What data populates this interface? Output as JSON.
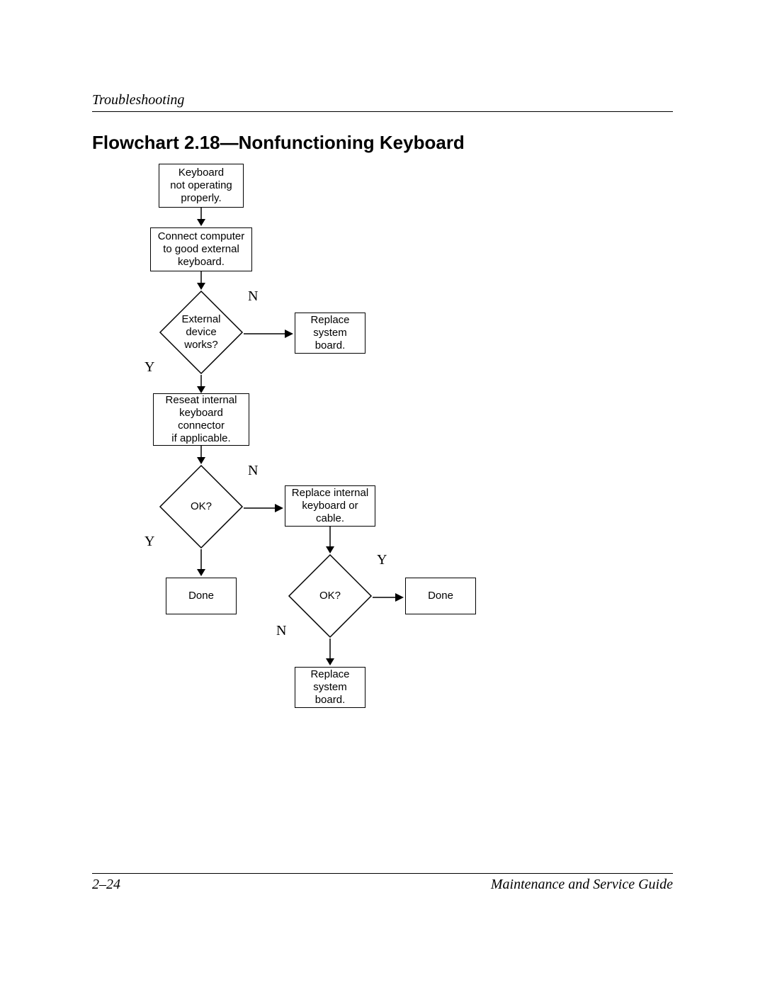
{
  "header": {
    "section": "Troubleshooting"
  },
  "title": "Flowchart 2.18—Nonfunctioning Keyboard",
  "nodes": {
    "start": "Keyboard\nnot operating\nproperly.",
    "connect": "Connect computer\nto good external\nkeyboard.",
    "d1": "External\ndevice\nworks?",
    "replace_sb1": "Replace\nsystem\nboard.",
    "reseat": "Reseat internal\nkeyboard\nconnector\nif applicable.",
    "d2": "OK?",
    "done1": "Done",
    "replace_kb": "Replace internal\nkeyboard or\ncable.",
    "d3": "OK?",
    "done2": "Done",
    "replace_sb2": "Replace\nsystem\nboard."
  },
  "labels": {
    "Y": "Y",
    "N": "N"
  },
  "footer": {
    "page": "2–24",
    "doc": "Maintenance and Service Guide"
  }
}
